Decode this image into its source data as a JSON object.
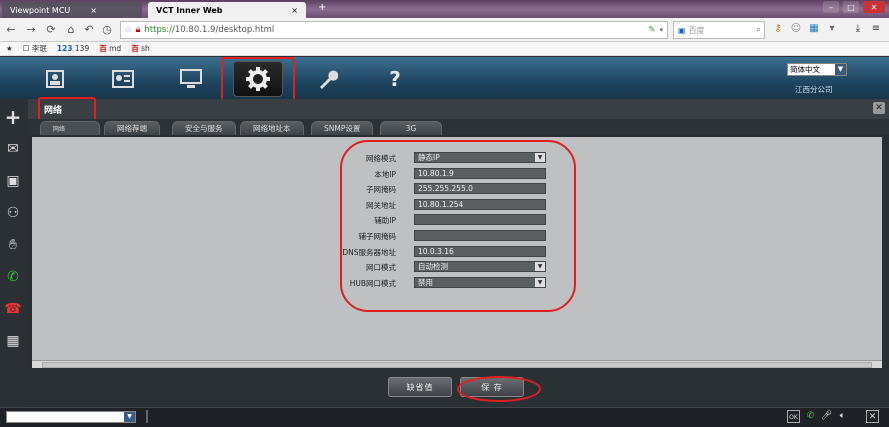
{
  "browser": {
    "tabs": [
      {
        "title": "Viewpoint MCU",
        "close": "×"
      },
      {
        "title": "VCT Inner Web",
        "close": "×"
      }
    ],
    "new_tab": "+",
    "url_scheme": "https://",
    "url_rest": "10.80.1.9/desktop.html",
    "search_placeholder": "百度",
    "bookmarks": [
      {
        "icon": "☐",
        "label": "李珉"
      },
      {
        "icon": "123",
        "label": "139"
      },
      {
        "icon": "百",
        "label": "md"
      },
      {
        "icon": "百",
        "label": "sh"
      }
    ]
  },
  "app": {
    "language": "简体中文",
    "company": "江西分公司",
    "page_title": "网络",
    "sub_tabs": [
      "网络",
      "网络荐端",
      "安全与服务",
      "网络地址本",
      "SNMP设置",
      "3G"
    ],
    "form": [
      {
        "label": "网络模式",
        "value": "静态IP",
        "dropdown": true
      },
      {
        "label": "本地IP",
        "value": "10.80.1.9",
        "dropdown": false
      },
      {
        "label": "子网掩码",
        "value": "255.255.255.0",
        "dropdown": false
      },
      {
        "label": "网关地址",
        "value": "10.80.1.254",
        "dropdown": false
      },
      {
        "label": "辅助IP",
        "value": "",
        "dropdown": false
      },
      {
        "label": "辅子网掩码",
        "value": "",
        "dropdown": false
      },
      {
        "label": "DNS服务器地址",
        "value": "10.0.3.16",
        "dropdown": false
      },
      {
        "label": "网口模式",
        "value": "自动检测",
        "dropdown": true
      },
      {
        "label": "HUB网口模式",
        "value": "禁用",
        "dropdown": true
      }
    ],
    "buttons": {
      "default": "缺省值",
      "save": "保 存"
    }
  }
}
